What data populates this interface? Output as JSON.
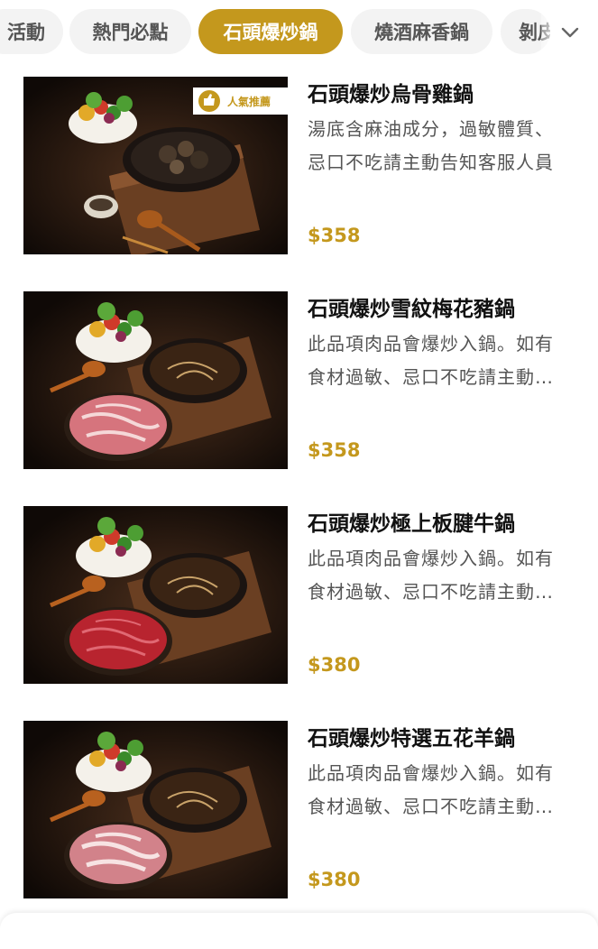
{
  "tabs": [
    {
      "label": "活動",
      "active": false
    },
    {
      "label": "熱門必點",
      "active": false
    },
    {
      "label": "石頭爆炒鍋",
      "active": true
    },
    {
      "label": "燒酒麻香鍋",
      "active": false
    },
    {
      "label": "剝皮",
      "active": false
    }
  ],
  "colors": {
    "accent": "#c4981d",
    "tab_bg": "#f3f3f3"
  },
  "items": [
    {
      "title": "石頭爆炒烏骨雞鍋",
      "desc": "湯底含麻油成分，過敏體質、忌口不吃請主動告知客服人員",
      "price": "$358",
      "badge": "人氣推薦",
      "broth": "dark",
      "meat": "none"
    },
    {
      "title": "石頭爆炒雪紋梅花豬鍋",
      "desc": "此品項肉品會爆炒入鍋。如有食材過敏、忌口不吃請主動告知",
      "price": "$358",
      "badge": "",
      "broth": "clear",
      "meat": "pork"
    },
    {
      "title": "石頭爆炒極上板腱牛鍋",
      "desc": "此品項肉品會爆炒入鍋。如有食材過敏、忌口不吃請主動告知",
      "price": "$380",
      "badge": "",
      "broth": "clear",
      "meat": "beef"
    },
    {
      "title": "石頭爆炒特選五花羊鍋",
      "desc": "此品項肉品會爆炒入鍋。如有食材過敏、忌口不吃請主動告知",
      "price": "$380",
      "badge": "",
      "broth": "clear",
      "meat": "lamb"
    }
  ]
}
